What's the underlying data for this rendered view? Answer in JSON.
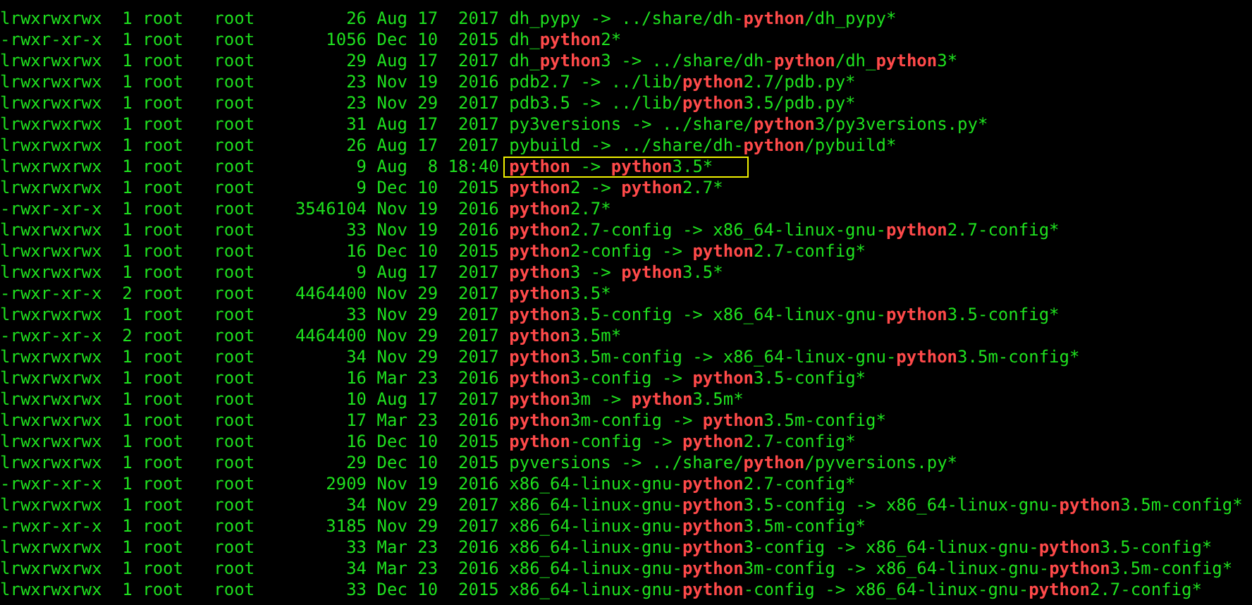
{
  "rows": [
    {
      "perms": "lrwxrwxrwx",
      "links": "1",
      "owner": "root",
      "group": "root",
      "size": "26",
      "month": "Aug",
      "day": "17",
      "time": "2017",
      "name": "dh_pypy -> ../share/dh-**python**/dh_pypy*",
      "highlighted": false
    },
    {
      "perms": "-rwxr-xr-x",
      "links": "1",
      "owner": "root",
      "group": "root",
      "size": "1056",
      "month": "Dec",
      "day": "10",
      "time": "2015",
      "name": "dh_**python**2*",
      "highlighted": false
    },
    {
      "perms": "lrwxrwxrwx",
      "links": "1",
      "owner": "root",
      "group": "root",
      "size": "29",
      "month": "Aug",
      "day": "17",
      "time": "2017",
      "name": "dh_**python**3 -> ../share/dh-**python**/dh_**python**3*",
      "highlighted": false
    },
    {
      "perms": "lrwxrwxrwx",
      "links": "1",
      "owner": "root",
      "group": "root",
      "size": "23",
      "month": "Nov",
      "day": "19",
      "time": "2016",
      "name": "pdb2.7 -> ../lib/**python**2.7/pdb.py*",
      "highlighted": false
    },
    {
      "perms": "lrwxrwxrwx",
      "links": "1",
      "owner": "root",
      "group": "root",
      "size": "23",
      "month": "Nov",
      "day": "29",
      "time": "2017",
      "name": "pdb3.5 -> ../lib/**python**3.5/pdb.py*",
      "highlighted": false
    },
    {
      "perms": "lrwxrwxrwx",
      "links": "1",
      "owner": "root",
      "group": "root",
      "size": "31",
      "month": "Aug",
      "day": "17",
      "time": "2017",
      "name": "py3versions -> ../share/**python**3/py3versions.py*",
      "highlighted": false
    },
    {
      "perms": "lrwxrwxrwx",
      "links": "1",
      "owner": "root",
      "group": "root",
      "size": "26",
      "month": "Aug",
      "day": "17",
      "time": "2017",
      "name": "pybuild -> ../share/dh-**python**/pybuild*",
      "highlighted": false
    },
    {
      "perms": "lrwxrwxrwx",
      "links": "1",
      "owner": "root",
      "group": "root",
      "size": "9",
      "month": "Aug",
      "day": "8",
      "time": "18:40",
      "name": "**python** -> **python**3.5*",
      "highlighted": true
    },
    {
      "perms": "lrwxrwxrwx",
      "links": "1",
      "owner": "root",
      "group": "root",
      "size": "9",
      "month": "Dec",
      "day": "10",
      "time": "2015",
      "name": "**python**2 -> **python**2.7*",
      "highlighted": false
    },
    {
      "perms": "-rwxr-xr-x",
      "links": "1",
      "owner": "root",
      "group": "root",
      "size": "3546104",
      "month": "Nov",
      "day": "19",
      "time": "2016",
      "name": "**python**2.7*",
      "highlighted": false
    },
    {
      "perms": "lrwxrwxrwx",
      "links": "1",
      "owner": "root",
      "group": "root",
      "size": "33",
      "month": "Nov",
      "day": "19",
      "time": "2016",
      "name": "**python**2.7-config -> x86_64-linux-gnu-**python**2.7-config*",
      "highlighted": false
    },
    {
      "perms": "lrwxrwxrwx",
      "links": "1",
      "owner": "root",
      "group": "root",
      "size": "16",
      "month": "Dec",
      "day": "10",
      "time": "2015",
      "name": "**python**2-config -> **python**2.7-config*",
      "highlighted": false
    },
    {
      "perms": "lrwxrwxrwx",
      "links": "1",
      "owner": "root",
      "group": "root",
      "size": "9",
      "month": "Aug",
      "day": "17",
      "time": "2017",
      "name": "**python**3 -> **python**3.5*",
      "highlighted": false
    },
    {
      "perms": "-rwxr-xr-x",
      "links": "2",
      "owner": "root",
      "group": "root",
      "size": "4464400",
      "month": "Nov",
      "day": "29",
      "time": "2017",
      "name": "**python**3.5*",
      "highlighted": false
    },
    {
      "perms": "lrwxrwxrwx",
      "links": "1",
      "owner": "root",
      "group": "root",
      "size": "33",
      "month": "Nov",
      "day": "29",
      "time": "2017",
      "name": "**python**3.5-config -> x86_64-linux-gnu-**python**3.5-config*",
      "highlighted": false
    },
    {
      "perms": "-rwxr-xr-x",
      "links": "2",
      "owner": "root",
      "group": "root",
      "size": "4464400",
      "month": "Nov",
      "day": "29",
      "time": "2017",
      "name": "**python**3.5m*",
      "highlighted": false
    },
    {
      "perms": "lrwxrwxrwx",
      "links": "1",
      "owner": "root",
      "group": "root",
      "size": "34",
      "month": "Nov",
      "day": "29",
      "time": "2017",
      "name": "**python**3.5m-config -> x86_64-linux-gnu-**python**3.5m-config*",
      "highlighted": false
    },
    {
      "perms": "lrwxrwxrwx",
      "links": "1",
      "owner": "root",
      "group": "root",
      "size": "16",
      "month": "Mar",
      "day": "23",
      "time": "2016",
      "name": "**python**3-config -> **python**3.5-config*",
      "highlighted": false
    },
    {
      "perms": "lrwxrwxrwx",
      "links": "1",
      "owner": "root",
      "group": "root",
      "size": "10",
      "month": "Aug",
      "day": "17",
      "time": "2017",
      "name": "**python**3m -> **python**3.5m*",
      "highlighted": false
    },
    {
      "perms": "lrwxrwxrwx",
      "links": "1",
      "owner": "root",
      "group": "root",
      "size": "17",
      "month": "Mar",
      "day": "23",
      "time": "2016",
      "name": "**python**3m-config -> **python**3.5m-config*",
      "highlighted": false
    },
    {
      "perms": "lrwxrwxrwx",
      "links": "1",
      "owner": "root",
      "group": "root",
      "size": "16",
      "month": "Dec",
      "day": "10",
      "time": "2015",
      "name": "**python**-config -> **python**2.7-config*",
      "highlighted": false
    },
    {
      "perms": "lrwxrwxrwx",
      "links": "1",
      "owner": "root",
      "group": "root",
      "size": "29",
      "month": "Dec",
      "day": "10",
      "time": "2015",
      "name": "pyversions -> ../share/**python**/pyversions.py*",
      "highlighted": false
    },
    {
      "perms": "-rwxr-xr-x",
      "links": "1",
      "owner": "root",
      "group": "root",
      "size": "2909",
      "month": "Nov",
      "day": "19",
      "time": "2016",
      "name": "x86_64-linux-gnu-**python**2.7-config*",
      "highlighted": false
    },
    {
      "perms": "lrwxrwxrwx",
      "links": "1",
      "owner": "root",
      "group": "root",
      "size": "34",
      "month": "Nov",
      "day": "29",
      "time": "2017",
      "name": "x86_64-linux-gnu-**python**3.5-config -> x86_64-linux-gnu-**python**3.5m-config*",
      "highlighted": false
    },
    {
      "perms": "-rwxr-xr-x",
      "links": "1",
      "owner": "root",
      "group": "root",
      "size": "3185",
      "month": "Nov",
      "day": "29",
      "time": "2017",
      "name": "x86_64-linux-gnu-**python**3.5m-config*",
      "highlighted": false
    },
    {
      "perms": "lrwxrwxrwx",
      "links": "1",
      "owner": "root",
      "group": "root",
      "size": "33",
      "month": "Mar",
      "day": "23",
      "time": "2016",
      "name": "x86_64-linux-gnu-**python**3-config -> x86_64-linux-gnu-**python**3.5-config*",
      "highlighted": false
    },
    {
      "perms": "lrwxrwxrwx",
      "links": "1",
      "owner": "root",
      "group": "root",
      "size": "34",
      "month": "Mar",
      "day": "23",
      "time": "2016",
      "name": "x86_64-linux-gnu-**python**3m-config -> x86_64-linux-gnu-**python**3.5m-config*",
      "highlighted": false
    },
    {
      "perms": "lrwxrwxrwx",
      "links": "1",
      "owner": "root",
      "group": "root",
      "size": "33",
      "month": "Dec",
      "day": "10",
      "time": "2015",
      "name": "x86_64-linux-gnu-**python**-config -> x86_64-linux-gnu-**python**2.7-config*",
      "highlighted": false
    }
  ]
}
